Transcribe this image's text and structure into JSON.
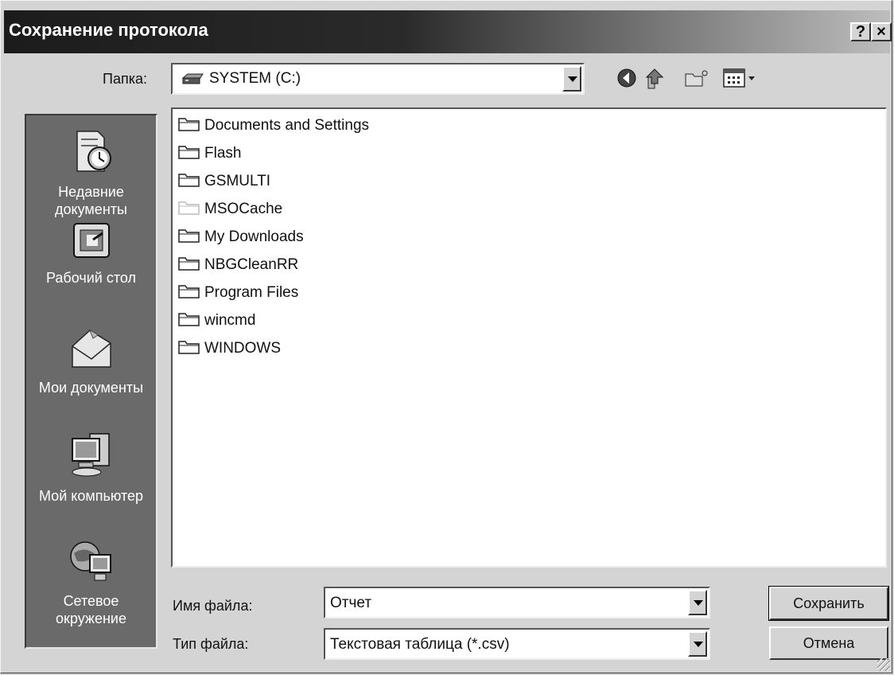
{
  "window": {
    "title": "Сохранение протокола",
    "help_button": "?",
    "close_button": "×"
  },
  "location": {
    "label": "Папка:",
    "value": "SYSTEM (C:)"
  },
  "toolbar": {
    "icons": [
      "back-icon",
      "up-folder-icon",
      "new-folder-icon",
      "view-menu-icon"
    ]
  },
  "places": [
    {
      "label": "Недавние документы",
      "icon": "recent-documents-icon"
    },
    {
      "label": "Рабочий стол",
      "icon": "desktop-icon"
    },
    {
      "label": "Мои документы",
      "icon": "my-documents-icon"
    },
    {
      "label": "Мой компьютер",
      "icon": "my-computer-icon"
    },
    {
      "label": "Сетевое окружение",
      "icon": "network-icon"
    }
  ],
  "files": [
    {
      "name": "Documents and Settings",
      "hidden": false
    },
    {
      "name": "Flash",
      "hidden": false
    },
    {
      "name": "GSMULTI",
      "hidden": false
    },
    {
      "name": "MSOCache",
      "hidden": true
    },
    {
      "name": "My Downloads",
      "hidden": false
    },
    {
      "name": "NBGCleanRR",
      "hidden": false
    },
    {
      "name": "Program Files",
      "hidden": false
    },
    {
      "name": "wincmd",
      "hidden": false
    },
    {
      "name": "WINDOWS",
      "hidden": false
    }
  ],
  "filename": {
    "label": "Имя файла:",
    "value": "Отчет"
  },
  "filetype": {
    "label": "Тип файла:",
    "value": "Текстовая таблица (*.csv)"
  },
  "buttons": {
    "save": "Сохранить",
    "cancel": "Отмена"
  }
}
